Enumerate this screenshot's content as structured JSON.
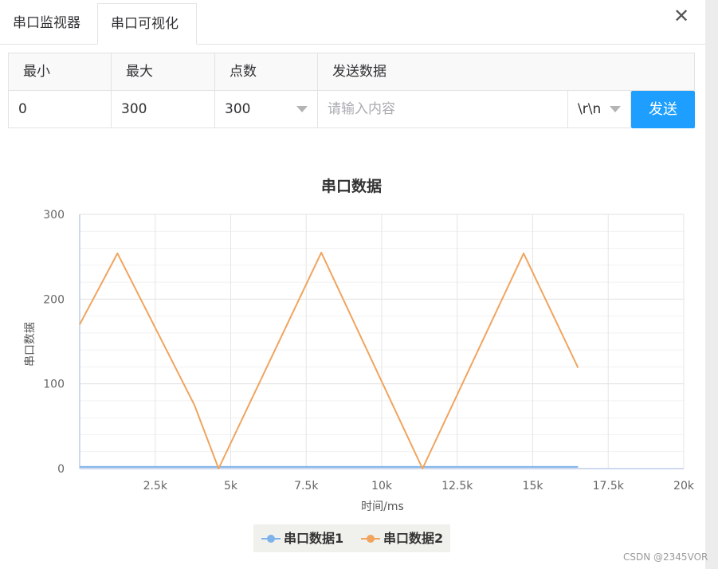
{
  "tabs": [
    {
      "label": "串口监视器",
      "active": false
    },
    {
      "label": "串口可视化",
      "active": true
    }
  ],
  "close_icon": "close-icon",
  "form": {
    "headers": {
      "min": "最小",
      "max": "最大",
      "points": "点数",
      "send_data": "发送数据"
    },
    "min_value": "0",
    "max_value": "300",
    "points_value": "300",
    "send_placeholder": "请输入内容",
    "line_ending": "\\r\\n",
    "send_button": "发送"
  },
  "colors": {
    "accent": "#1e9fff",
    "series1": "#7eb2ea",
    "series2": "#f0a45e"
  },
  "chart_data": {
    "type": "line",
    "title": "串口数据",
    "xlabel": "时间/ms",
    "ylabel": "串口数据",
    "xlim": [
      0,
      20000
    ],
    "ylim": [
      0,
      300
    ],
    "xticks": [
      "2.5k",
      "5k",
      "7.5k",
      "10k",
      "12.5k",
      "15k",
      "17.5k",
      "20k"
    ],
    "yticks": [
      "0",
      "100",
      "200",
      "300"
    ],
    "grid": true,
    "legend_position": "bottom",
    "series": [
      {
        "name": "串口数据1",
        "x": [
          0,
          16500
        ],
        "y": [
          2,
          2
        ]
      },
      {
        "name": "串口数据2",
        "x": [
          0,
          1250,
          3800,
          4600,
          8000,
          11350,
          14700,
          16500
        ],
        "y": [
          170,
          254,
          75,
          0,
          255,
          0,
          254,
          119
        ]
      }
    ]
  },
  "watermark": "CSDN @2345VOR"
}
